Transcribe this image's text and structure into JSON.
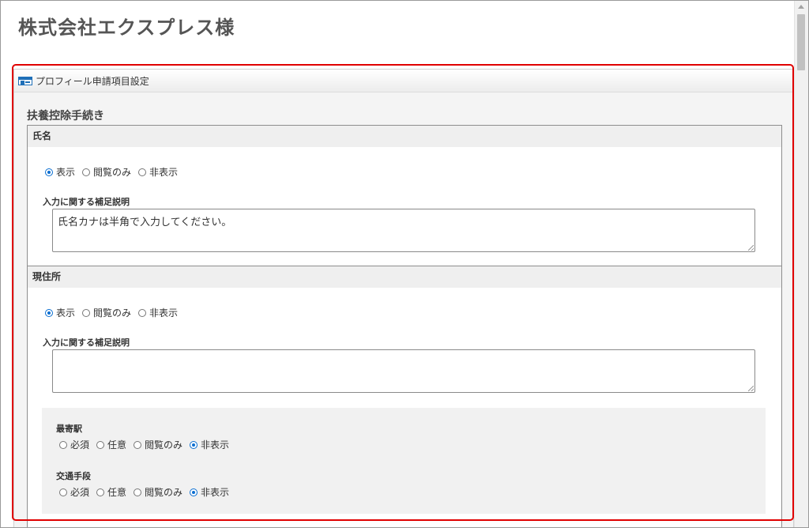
{
  "page": {
    "company_title": "株式会社エクスプレス様"
  },
  "panel": {
    "header": "プロフィール申請項目設定",
    "icon": "profile-card-icon",
    "section_title": "扶養控除手続き"
  },
  "fields": [
    {
      "label": "氏名",
      "options": [
        "表示",
        "閲覧のみ",
        "非表示"
      ],
      "selected": "表示",
      "help_label": "入力に関する補足説明",
      "help_value": "氏名カナは半角で入力してください。"
    },
    {
      "label": "現住所",
      "options": [
        "表示",
        "閲覧のみ",
        "非表示"
      ],
      "selected": "表示",
      "help_label": "入力に関する補足説明",
      "help_value": "",
      "subfields": [
        {
          "label": "最寄駅",
          "options": [
            "必須",
            "任意",
            "閲覧のみ",
            "非表示"
          ],
          "selected": "非表示"
        },
        {
          "label": "交通手段",
          "options": [
            "必須",
            "任意",
            "閲覧のみ",
            "非表示"
          ],
          "selected": "非表示"
        }
      ]
    }
  ],
  "colors": {
    "highlight_outline": "#e00000",
    "radio_accent": "#0a6ed1"
  }
}
